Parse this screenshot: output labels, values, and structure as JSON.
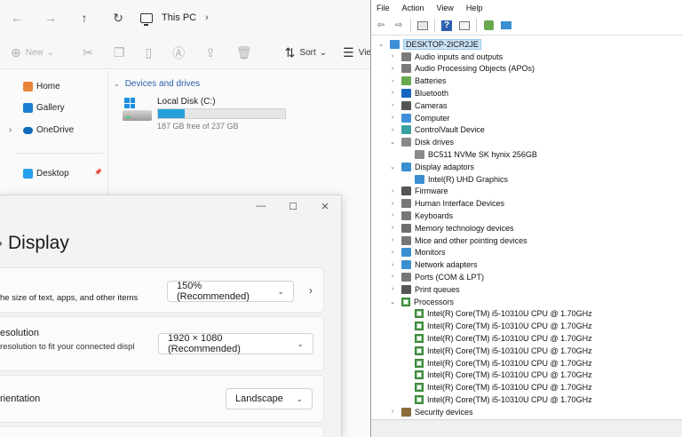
{
  "explorer": {
    "nav": {
      "back": "←",
      "forward": "→",
      "up": "↑",
      "refresh": "↻"
    },
    "address": {
      "location": "This PC",
      "chevron": "›"
    },
    "commands": {
      "new_label": "New",
      "new_caret": "⌄",
      "sort_label": "Sort",
      "sort_caret": "⌄",
      "view_label": "View"
    },
    "nav_items": [
      {
        "label": "Home",
        "icon": "home-icon",
        "color": "#e8843a"
      },
      {
        "label": "Gallery",
        "icon": "gallery-icon",
        "color": "#1a7fd4"
      },
      {
        "label": "OneDrive",
        "icon": "cloud-icon",
        "color": "#0f6cbd"
      },
      {
        "label": "Desktop",
        "icon": "desktop-icon",
        "color": "#24a0ed"
      }
    ],
    "onedrive_chevron": "›",
    "pin_glyph": "📌",
    "group_header": "Devices and drives",
    "group_chevron": "⌄",
    "drive": {
      "name": "Local Disk (C:)",
      "free_text": "187 GB free of 237 GB",
      "used_fraction": 0.21
    }
  },
  "settings": {
    "window_controls": {
      "minimize": "—",
      "maximize": "☐",
      "close": "✕"
    },
    "title": "Display",
    "title_glyph": "›",
    "scale_card": {
      "text": "he size of text, apps, and other items",
      "value": "150% (Recommended)",
      "arrow": "⌄",
      "go": "›"
    },
    "resolution_card": {
      "label": "esolution",
      "sub": "resolution to fit your connected displ",
      "value": "1920 × 1080 (Recommended)",
      "arrow": "⌄"
    },
    "orientation_card": {
      "label": "rientation",
      "value": "Landscape",
      "arrow": "⌄"
    }
  },
  "devmgr": {
    "menu": [
      "File",
      "Action",
      "View",
      "Help"
    ],
    "toolbar_glyphs": {
      "back": "⇦",
      "forward": "⇨",
      "help": "?"
    },
    "root": "DESKTOP-2ICR2JE",
    "nodes": [
      {
        "label": "Audio inputs and outputs",
        "exp": "›",
        "level": 1,
        "color": "#7a7a7a"
      },
      {
        "label": "Audio Processing Objects (APOs)",
        "exp": "›",
        "level": 1,
        "color": "#7a7a7a"
      },
      {
        "label": "Batteries",
        "exp": "›",
        "level": 1,
        "color": "#6aa84f"
      },
      {
        "label": "Bluetooth",
        "exp": "›",
        "level": 1,
        "color": "#1565c0"
      },
      {
        "label": "Cameras",
        "exp": "›",
        "level": 1,
        "color": "#555555"
      },
      {
        "label": "Computer",
        "exp": "›",
        "level": 1,
        "color": "#3f8fd6"
      },
      {
        "label": "ControlVault Device",
        "exp": "›",
        "level": 1,
        "color": "#3aa0a0"
      },
      {
        "label": "Disk drives",
        "exp": "⌄",
        "level": 1,
        "color": "#8a8a8a"
      },
      {
        "label": "BC511 NVMe SK hynix 256GB",
        "exp": "",
        "level": 2,
        "color": "#8a8a8a"
      },
      {
        "label": "Display adaptors",
        "exp": "⌄",
        "level": 1,
        "color": "#3a8fd0"
      },
      {
        "label": "Intel(R) UHD Graphics",
        "exp": "",
        "level": 2,
        "color": "#3a8fd0"
      },
      {
        "label": "Firmware",
        "exp": "›",
        "level": 1,
        "color": "#555555"
      },
      {
        "label": "Human Interface Devices",
        "exp": "›",
        "level": 1,
        "color": "#777777"
      },
      {
        "label": "Keyboards",
        "exp": "›",
        "level": 1,
        "color": "#777777"
      },
      {
        "label": "Memory technology devices",
        "exp": "›",
        "level": 1,
        "color": "#6d6d6d"
      },
      {
        "label": "Mice and other pointing devices",
        "exp": "›",
        "level": 1,
        "color": "#777777"
      },
      {
        "label": "Monitors",
        "exp": "›",
        "level": 1,
        "color": "#3a8fd0"
      },
      {
        "label": "Network adapters",
        "exp": "›",
        "level": 1,
        "color": "#3a8fd0"
      },
      {
        "label": "Ports (COM & LPT)",
        "exp": "›",
        "level": 1,
        "color": "#777777"
      },
      {
        "label": "Print queues",
        "exp": "›",
        "level": 1,
        "color": "#555555"
      },
      {
        "label": "Processors",
        "exp": "⌄",
        "level": 1,
        "color": "#3d8a3d",
        "cpu": true
      },
      {
        "label": "Intel(R) Core(TM) i5-10310U CPU @ 1.70GHz",
        "exp": "",
        "level": 2,
        "cpu": true
      },
      {
        "label": "Intel(R) Core(TM) i5-10310U CPU @ 1.70GHz",
        "exp": "",
        "level": 2,
        "cpu": true
      },
      {
        "label": "Intel(R) Core(TM) i5-10310U CPU @ 1.70GHz",
        "exp": "",
        "level": 2,
        "cpu": true
      },
      {
        "label": "Intel(R) Core(TM) i5-10310U CPU @ 1.70GHz",
        "exp": "",
        "level": 2,
        "cpu": true
      },
      {
        "label": "Intel(R) Core(TM) i5-10310U CPU @ 1.70GHz",
        "exp": "",
        "level": 2,
        "cpu": true
      },
      {
        "label": "Intel(R) Core(TM) i5-10310U CPU @ 1.70GHz",
        "exp": "",
        "level": 2,
        "cpu": true
      },
      {
        "label": "Intel(R) Core(TM) i5-10310U CPU @ 1.70GHz",
        "exp": "",
        "level": 2,
        "cpu": true
      },
      {
        "label": "Intel(R) Core(TM) i5-10310U CPU @ 1.70GHz",
        "exp": "",
        "level": 2,
        "cpu": true
      },
      {
        "label": "Security devices",
        "exp": "›",
        "level": 1,
        "color": "#8a6d3b"
      }
    ]
  }
}
